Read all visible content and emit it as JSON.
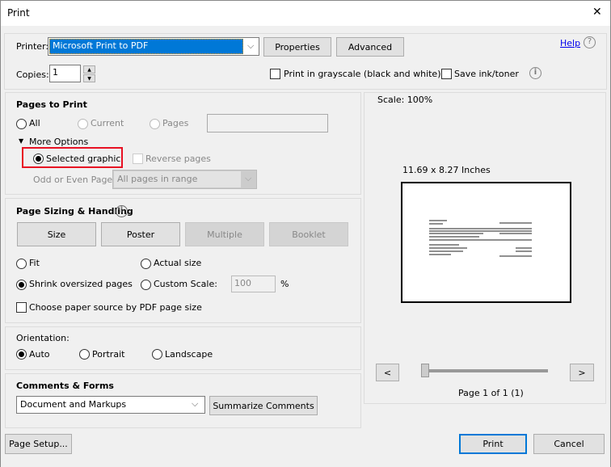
{
  "window": {
    "title": "Print",
    "close": "✕"
  },
  "printer": {
    "label": "Printer:",
    "value": "Microsoft Print to PDF",
    "properties": "Properties",
    "advanced": "Advanced",
    "help": "Help"
  },
  "copies": {
    "label": "Copies:",
    "value": "1",
    "grayscale": "Print in grayscale (black and white)",
    "save_ink": "Save ink/toner"
  },
  "pages": {
    "title": "Pages to Print",
    "all": "All",
    "current": "Current",
    "pages": "Pages",
    "pages_value": "",
    "more_options": "More Options",
    "selected_graphic": "Selected graphic",
    "reverse": "Reverse pages",
    "odd_even_label": "Odd or Even Pages:",
    "odd_even_value": "All pages in range"
  },
  "sizing": {
    "title": "Page Sizing & Handling",
    "size": "Size",
    "poster": "Poster",
    "multiple": "Multiple",
    "booklet": "Booklet",
    "fit": "Fit",
    "actual": "Actual size",
    "shrink": "Shrink oversized pages",
    "custom": "Custom Scale:",
    "custom_value": "100",
    "percent": "%",
    "paper_source": "Choose paper source by PDF page size"
  },
  "orientation": {
    "title": "Orientation:",
    "auto": "Auto",
    "portrait": "Portrait",
    "landscape": "Landscape"
  },
  "comments": {
    "title": "Comments & Forms",
    "value": "Document and Markups",
    "summarize": "Summarize Comments"
  },
  "preview": {
    "scale": "Scale: 100%",
    "dimensions": "11.69 x 8.27 Inches",
    "prev": "<",
    "next": ">",
    "page_info": "Page 1 of 1 (1)",
    "slider_position": 0
  },
  "footer": {
    "page_setup": "Page Setup...",
    "print": "Print",
    "cancel": "Cancel"
  },
  "colors": {
    "highlight": "#0078d7",
    "red_outline": "#e81123",
    "link": "#0000ee"
  }
}
